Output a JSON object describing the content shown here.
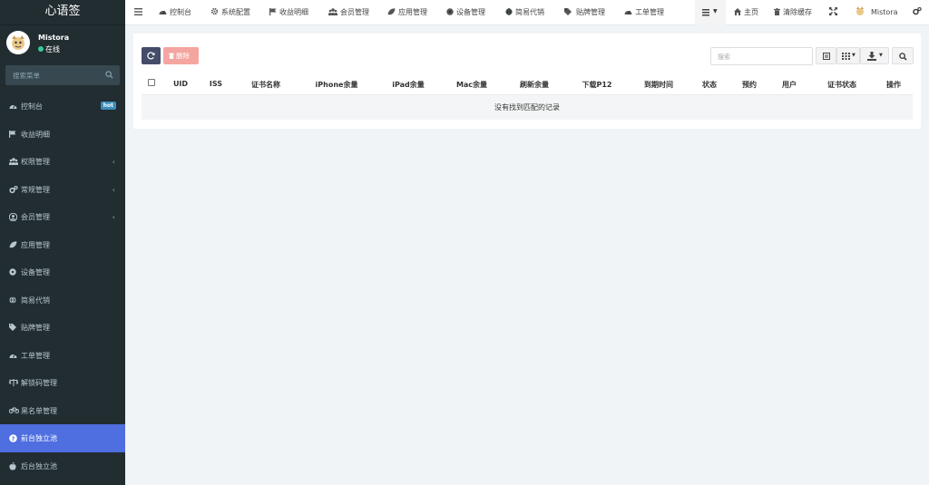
{
  "app": {
    "title": "心语签"
  },
  "user": {
    "name": "Mistora",
    "status": "在线"
  },
  "sidebar": {
    "search_placeholder": "搜索菜单",
    "items": [
      {
        "label": "控制台",
        "icon": "dashboard-icon",
        "badge": "hot"
      },
      {
        "label": "收益明细",
        "icon": "flag-icon"
      },
      {
        "label": "权限管理",
        "icon": "users-icon",
        "arrow": "‹"
      },
      {
        "label": "常规管理",
        "icon": "cogs-icon",
        "arrow": "‹"
      },
      {
        "label": "会员管理",
        "icon": "user-circle-icon",
        "arrow": "‹"
      },
      {
        "label": "应用管理",
        "icon": "leaf-icon"
      },
      {
        "label": "设备管理",
        "icon": "circle-icon"
      },
      {
        "label": "简易代销",
        "icon": "globe-icon"
      },
      {
        "label": "贴牌管理",
        "icon": "tags-icon"
      },
      {
        "label": "工单管理",
        "icon": "dashboard-icon"
      },
      {
        "label": "解锁码管理",
        "icon": "balance-scale-icon"
      },
      {
        "label": "黑名单管理",
        "icon": "bicycle-icon"
      },
      {
        "label": "前台独立池",
        "icon": "question-circle-icon",
        "active": true
      },
      {
        "label": "后台独立池",
        "icon": "apple-icon"
      }
    ]
  },
  "topbar": {
    "menu_icon": "hamburger-icon",
    "nav": [
      {
        "label": "控制台",
        "icon": "dashboard-icon"
      },
      {
        "label": "系统配置",
        "icon": "gear-icon"
      },
      {
        "label": "收益明细",
        "icon": "flag-icon"
      },
      {
        "label": "会员管理",
        "icon": "users-icon"
      },
      {
        "label": "应用管理",
        "icon": "leaf-icon"
      },
      {
        "label": "设备管理",
        "icon": "circle-icon"
      },
      {
        "label": "简易代销",
        "icon": "globe-icon"
      },
      {
        "label": "贴牌管理",
        "icon": "tags-icon"
      },
      {
        "label": "工单管理",
        "icon": "dashboard-icon"
      }
    ],
    "home": "主页",
    "clear_cache": "清除缓存",
    "user": "Mistora"
  },
  "toolbar": {
    "delete_label": "删除",
    "search_placeholder": "搜索"
  },
  "table": {
    "columns": [
      "UID",
      "ISS",
      "证书名称",
      "iPhone余量",
      "iPad余量",
      "Mac余量",
      "刷新余量",
      "下载P12",
      "到期时间",
      "状态",
      "预约",
      "用户",
      "证书状态",
      "操作"
    ],
    "empty_text": "没有找到匹配的记录"
  },
  "colors": {
    "sidebar_bg": "#222d32",
    "active_item": "#4f6ee0",
    "refresh_btn": "#444c69",
    "delete_btn": "#f4a5a0",
    "online_dot": "#33cc99"
  }
}
